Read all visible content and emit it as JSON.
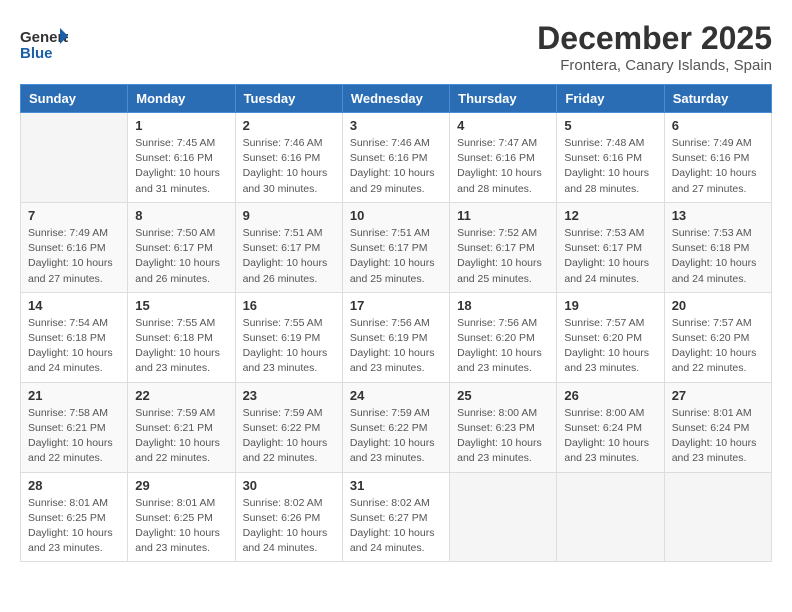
{
  "logo": {
    "general": "General",
    "blue": "Blue"
  },
  "title": "December 2025",
  "location": "Frontera, Canary Islands, Spain",
  "days_of_week": [
    "Sunday",
    "Monday",
    "Tuesday",
    "Wednesday",
    "Thursday",
    "Friday",
    "Saturday"
  ],
  "weeks": [
    [
      {
        "day": "",
        "sunrise": "",
        "sunset": "",
        "daylight": ""
      },
      {
        "day": "1",
        "sunrise": "Sunrise: 7:45 AM",
        "sunset": "Sunset: 6:16 PM",
        "daylight": "Daylight: 10 hours and 31 minutes."
      },
      {
        "day": "2",
        "sunrise": "Sunrise: 7:46 AM",
        "sunset": "Sunset: 6:16 PM",
        "daylight": "Daylight: 10 hours and 30 minutes."
      },
      {
        "day": "3",
        "sunrise": "Sunrise: 7:46 AM",
        "sunset": "Sunset: 6:16 PM",
        "daylight": "Daylight: 10 hours and 29 minutes."
      },
      {
        "day": "4",
        "sunrise": "Sunrise: 7:47 AM",
        "sunset": "Sunset: 6:16 PM",
        "daylight": "Daylight: 10 hours and 28 minutes."
      },
      {
        "day": "5",
        "sunrise": "Sunrise: 7:48 AM",
        "sunset": "Sunset: 6:16 PM",
        "daylight": "Daylight: 10 hours and 28 minutes."
      },
      {
        "day": "6",
        "sunrise": "Sunrise: 7:49 AM",
        "sunset": "Sunset: 6:16 PM",
        "daylight": "Daylight: 10 hours and 27 minutes."
      }
    ],
    [
      {
        "day": "7",
        "sunrise": "Sunrise: 7:49 AM",
        "sunset": "Sunset: 6:16 PM",
        "daylight": "Daylight: 10 hours and 27 minutes."
      },
      {
        "day": "8",
        "sunrise": "Sunrise: 7:50 AM",
        "sunset": "Sunset: 6:17 PM",
        "daylight": "Daylight: 10 hours and 26 minutes."
      },
      {
        "day": "9",
        "sunrise": "Sunrise: 7:51 AM",
        "sunset": "Sunset: 6:17 PM",
        "daylight": "Daylight: 10 hours and 26 minutes."
      },
      {
        "day": "10",
        "sunrise": "Sunrise: 7:51 AM",
        "sunset": "Sunset: 6:17 PM",
        "daylight": "Daylight: 10 hours and 25 minutes."
      },
      {
        "day": "11",
        "sunrise": "Sunrise: 7:52 AM",
        "sunset": "Sunset: 6:17 PM",
        "daylight": "Daylight: 10 hours and 25 minutes."
      },
      {
        "day": "12",
        "sunrise": "Sunrise: 7:53 AM",
        "sunset": "Sunset: 6:17 PM",
        "daylight": "Daylight: 10 hours and 24 minutes."
      },
      {
        "day": "13",
        "sunrise": "Sunrise: 7:53 AM",
        "sunset": "Sunset: 6:18 PM",
        "daylight": "Daylight: 10 hours and 24 minutes."
      }
    ],
    [
      {
        "day": "14",
        "sunrise": "Sunrise: 7:54 AM",
        "sunset": "Sunset: 6:18 PM",
        "daylight": "Daylight: 10 hours and 24 minutes."
      },
      {
        "day": "15",
        "sunrise": "Sunrise: 7:55 AM",
        "sunset": "Sunset: 6:18 PM",
        "daylight": "Daylight: 10 hours and 23 minutes."
      },
      {
        "day": "16",
        "sunrise": "Sunrise: 7:55 AM",
        "sunset": "Sunset: 6:19 PM",
        "daylight": "Daylight: 10 hours and 23 minutes."
      },
      {
        "day": "17",
        "sunrise": "Sunrise: 7:56 AM",
        "sunset": "Sunset: 6:19 PM",
        "daylight": "Daylight: 10 hours and 23 minutes."
      },
      {
        "day": "18",
        "sunrise": "Sunrise: 7:56 AM",
        "sunset": "Sunset: 6:20 PM",
        "daylight": "Daylight: 10 hours and 23 minutes."
      },
      {
        "day": "19",
        "sunrise": "Sunrise: 7:57 AM",
        "sunset": "Sunset: 6:20 PM",
        "daylight": "Daylight: 10 hours and 23 minutes."
      },
      {
        "day": "20",
        "sunrise": "Sunrise: 7:57 AM",
        "sunset": "Sunset: 6:20 PM",
        "daylight": "Daylight: 10 hours and 22 minutes."
      }
    ],
    [
      {
        "day": "21",
        "sunrise": "Sunrise: 7:58 AM",
        "sunset": "Sunset: 6:21 PM",
        "daylight": "Daylight: 10 hours and 22 minutes."
      },
      {
        "day": "22",
        "sunrise": "Sunrise: 7:59 AM",
        "sunset": "Sunset: 6:21 PM",
        "daylight": "Daylight: 10 hours and 22 minutes."
      },
      {
        "day": "23",
        "sunrise": "Sunrise: 7:59 AM",
        "sunset": "Sunset: 6:22 PM",
        "daylight": "Daylight: 10 hours and 22 minutes."
      },
      {
        "day": "24",
        "sunrise": "Sunrise: 7:59 AM",
        "sunset": "Sunset: 6:22 PM",
        "daylight": "Daylight: 10 hours and 23 minutes."
      },
      {
        "day": "25",
        "sunrise": "Sunrise: 8:00 AM",
        "sunset": "Sunset: 6:23 PM",
        "daylight": "Daylight: 10 hours and 23 minutes."
      },
      {
        "day": "26",
        "sunrise": "Sunrise: 8:00 AM",
        "sunset": "Sunset: 6:24 PM",
        "daylight": "Daylight: 10 hours and 23 minutes."
      },
      {
        "day": "27",
        "sunrise": "Sunrise: 8:01 AM",
        "sunset": "Sunset: 6:24 PM",
        "daylight": "Daylight: 10 hours and 23 minutes."
      }
    ],
    [
      {
        "day": "28",
        "sunrise": "Sunrise: 8:01 AM",
        "sunset": "Sunset: 6:25 PM",
        "daylight": "Daylight: 10 hours and 23 minutes."
      },
      {
        "day": "29",
        "sunrise": "Sunrise: 8:01 AM",
        "sunset": "Sunset: 6:25 PM",
        "daylight": "Daylight: 10 hours and 23 minutes."
      },
      {
        "day": "30",
        "sunrise": "Sunrise: 8:02 AM",
        "sunset": "Sunset: 6:26 PM",
        "daylight": "Daylight: 10 hours and 24 minutes."
      },
      {
        "day": "31",
        "sunrise": "Sunrise: 8:02 AM",
        "sunset": "Sunset: 6:27 PM",
        "daylight": "Daylight: 10 hours and 24 minutes."
      },
      {
        "day": "",
        "sunrise": "",
        "sunset": "",
        "daylight": ""
      },
      {
        "day": "",
        "sunrise": "",
        "sunset": "",
        "daylight": ""
      },
      {
        "day": "",
        "sunrise": "",
        "sunset": "",
        "daylight": ""
      }
    ]
  ]
}
